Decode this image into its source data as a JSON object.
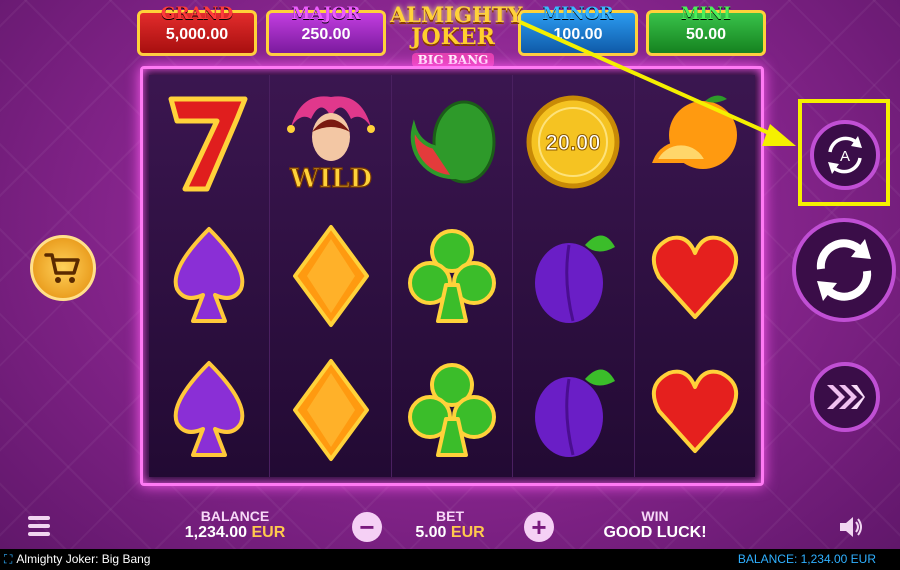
{
  "jackpots": [
    {
      "name": "GRAND",
      "value": "5,000.00"
    },
    {
      "name": "MAJOR",
      "value": "250.00"
    },
    {
      "name": "MINOR",
      "value": "100.00"
    },
    {
      "name": "MINI",
      "value": "50.00"
    }
  ],
  "logo": {
    "line1": "ALMIGHTY",
    "line2": "JOKER",
    "line3": "BIG BANG"
  },
  "reels": [
    [
      "seven",
      "spade",
      "spade"
    ],
    [
      "joker-wild",
      "diamond",
      "diamond"
    ],
    [
      "watermelon",
      "club",
      "club"
    ],
    [
      "coin",
      "plum",
      "plum"
    ],
    [
      "orange",
      "heart",
      "heart"
    ]
  ],
  "symbols": {
    "wild_label": "WILD",
    "coin_value": "20.00"
  },
  "bottom": {
    "balance_label": "BALANCE",
    "balance_value": "1,234.00",
    "balance_currency": "EUR",
    "bet_label": "BET",
    "bet_value": "5.00",
    "bet_currency": "EUR",
    "win_label": "WIN",
    "win_value": "GOOD LUCK!",
    "minus": "−",
    "plus": "+"
  },
  "status": {
    "title": "Almighty Joker: Big Bang",
    "balance": "BALANCE: 1,234.00 EUR"
  },
  "buttons": {
    "autoplay": "A"
  },
  "highlight": {
    "target": "autoplay-button",
    "color": "#f5f000"
  }
}
